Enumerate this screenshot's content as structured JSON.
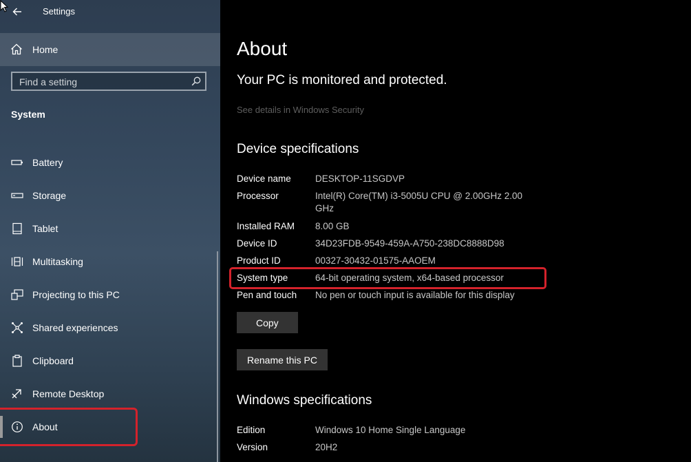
{
  "window": {
    "title": "Settings"
  },
  "sidebar": {
    "home_label": "Home",
    "search": {
      "placeholder": "Find a setting"
    },
    "section": "System",
    "items": [
      {
        "label": "Battery",
        "icon": "battery-icon"
      },
      {
        "label": "Storage",
        "icon": "storage-icon"
      },
      {
        "label": "Tablet",
        "icon": "tablet-icon"
      },
      {
        "label": "Multitasking",
        "icon": "multitasking-icon"
      },
      {
        "label": "Projecting to this PC",
        "icon": "projecting-icon"
      },
      {
        "label": "Shared experiences",
        "icon": "shared-experiences-icon"
      },
      {
        "label": "Clipboard",
        "icon": "clipboard-icon"
      },
      {
        "label": "Remote Desktop",
        "icon": "remote-desktop-icon"
      },
      {
        "label": "About",
        "icon": "info-icon",
        "selected": true
      }
    ]
  },
  "main": {
    "title": "About",
    "protection_text": "Your PC is monitored and protected.",
    "security_link": "See details in Windows Security",
    "device_heading": "Device specifications",
    "device_specs": [
      {
        "key": "Device name",
        "value": "DESKTOP-11SGDVP"
      },
      {
        "key": "Processor",
        "value": "Intel(R) Core(TM) i3-5005U CPU @ 2.00GHz   2.00 GHz"
      },
      {
        "key": "Installed RAM",
        "value": "8.00 GB"
      },
      {
        "key": "Device ID",
        "value": "34D23FDB-9549-459A-A750-238DC8888D98"
      },
      {
        "key": "Product ID",
        "value": "00327-30432-01575-AAOEM"
      },
      {
        "key": "System type",
        "value": "64-bit operating system, x64-based processor"
      },
      {
        "key": "Pen and touch",
        "value": "No pen or touch input is available for this display"
      }
    ],
    "copy_label": "Copy",
    "rename_label": "Rename this PC",
    "windows_heading": "Windows specifications",
    "windows_specs": [
      {
        "key": "Edition",
        "value": "Windows 10 Home Single Language"
      },
      {
        "key": "Version",
        "value": "20H2"
      }
    ]
  },
  "colors": {
    "highlight": "#d4222b",
    "sidebar": "#34475c",
    "main_bg": "#000000"
  }
}
